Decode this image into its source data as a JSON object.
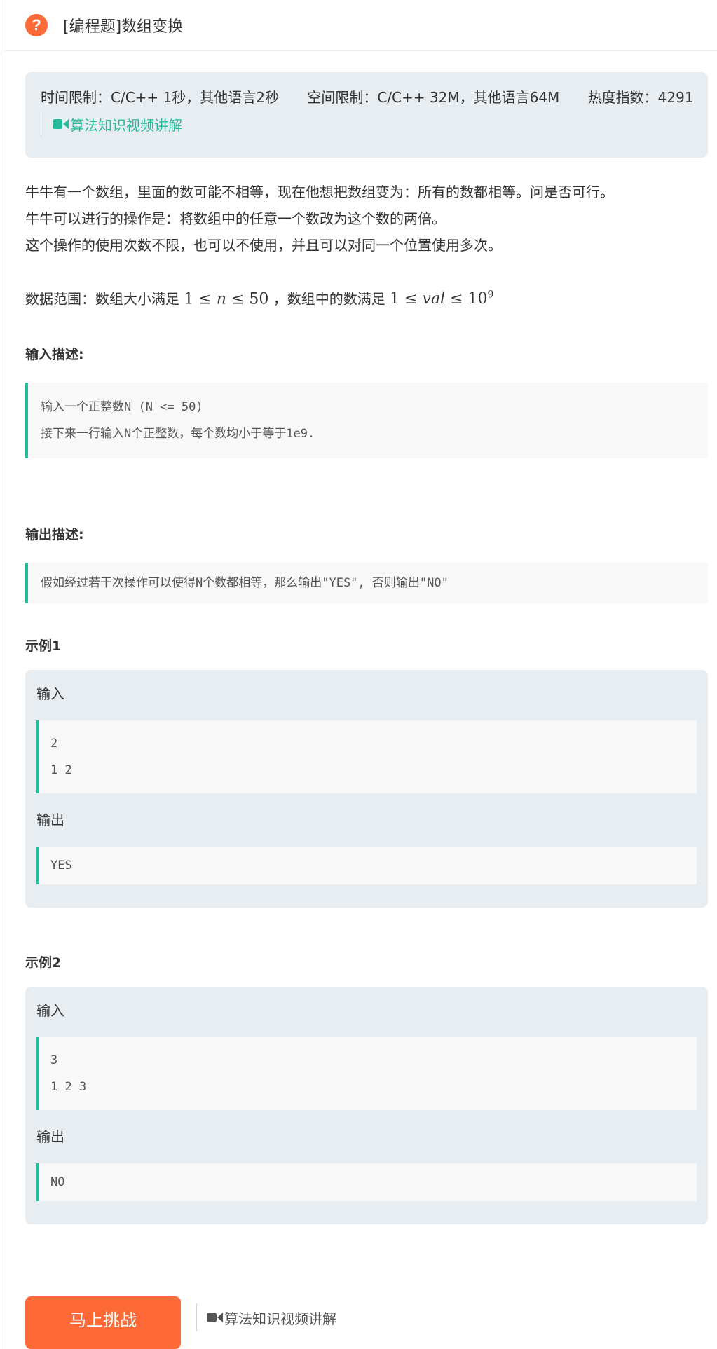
{
  "header": {
    "title": "[编程题]数组变换"
  },
  "limits": {
    "time": "时间限制：C/C++ 1秒，其他语言2秒",
    "space": "空间限制：C/C++ 32M，其他语言64M",
    "heat": "热度指数：4291",
    "video_link": "算法知识视频讲解"
  },
  "description": {
    "lines": [
      "牛牛有一个数组，里面的数可能不相等，现在他想把数组变为：所有的数都相等。问是否可行。",
      "牛牛可以进行的操作是：将数组中的任意一个数改为这个数的两倍。",
      "这个操作的使用次数不限，也可以不使用，并且可以对同一个位置使用多次。"
    ],
    "range_prefix": "数据范围：数组大小满足 ",
    "range_mid": " ，数组中的数满足 "
  },
  "input_desc": {
    "title": "输入描述:",
    "lines": [
      "输入一个正整数N (N <= 50)",
      "接下来一行输入N个正整数，每个数均小于等于1e9."
    ]
  },
  "output_desc": {
    "title": "输出描述:",
    "lines": [
      "假如经过若干次操作可以使得N个数都相等，那么输出\"YES\", 否则输出\"NO\""
    ]
  },
  "examples": [
    {
      "title": "示例1",
      "input_label": "输入",
      "input": [
        "2",
        "1 2"
      ],
      "output_label": "输出",
      "output": [
        "YES"
      ]
    },
    {
      "title": "示例2",
      "input_label": "输入",
      "input": [
        "3",
        "1 2 3"
      ],
      "output_label": "输出",
      "output": [
        "NO"
      ]
    }
  ],
  "footer": {
    "challenge_button": "马上挑战",
    "video_link": "算法知识视频讲解"
  },
  "colors": {
    "accent": "#25bb9b",
    "primary": "#fd6a38"
  },
  "icons": {
    "question": "question-icon",
    "video": "video-camera-icon"
  }
}
